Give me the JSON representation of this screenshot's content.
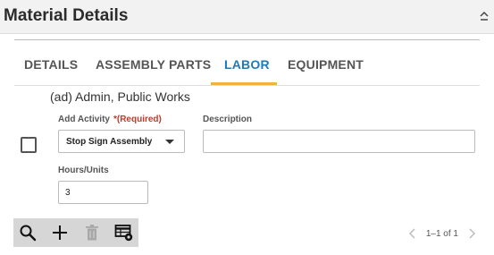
{
  "header": {
    "title": "Material Details",
    "collapse_icon": "chevron-up-icon"
  },
  "tabs": [
    {
      "label": "DETAILS",
      "active": false
    },
    {
      "label": "ASSEMBLY PARTS",
      "active": false
    },
    {
      "label": "LABOR",
      "active": true
    },
    {
      "label": "EQUIPMENT",
      "active": false
    }
  ],
  "labor": {
    "record_name": "(ad) Admin, Public Works",
    "add_activity": {
      "label": "Add Activity",
      "required": "*(Required)",
      "value": "Stop Sign Assembly"
    },
    "description": {
      "label": "Description",
      "value": ""
    },
    "hours_units": {
      "label": "Hours/Units",
      "value": "3"
    }
  },
  "toolbar": {
    "icons": [
      "search-icon",
      "add-icon",
      "delete-icon",
      "grid-settings-icon"
    ]
  },
  "pager": {
    "text": "1–1 of 1"
  },
  "colors": {
    "accent": "#1e7bb6",
    "tab_underline": "#f0b23a",
    "required": "#c0392b",
    "toolbar_bg": "#d6d6d6"
  }
}
